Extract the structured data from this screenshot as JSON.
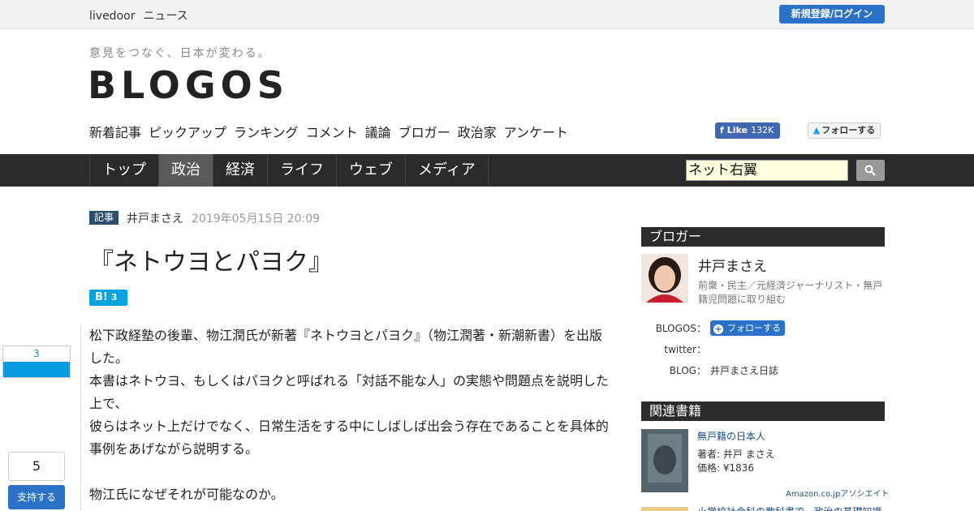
{
  "topbar": {
    "brand_1": "livedoor",
    "brand_2": "ニュース",
    "login_label": "新規登録/ログイン"
  },
  "header": {
    "tagline": "意見をつなぐ、日本が変わる。",
    "logo": "BLOGOS"
  },
  "subnav": [
    "新着記事",
    "ピックアップ",
    "ランキング",
    "コメント",
    "議論",
    "ブロガー",
    "政治家",
    "アンケート"
  ],
  "social": {
    "fb_like": "Like",
    "fb_count": "132K",
    "tw_follow": "フォローする"
  },
  "mainnav": {
    "tabs": [
      "トップ",
      "政治",
      "経済",
      "ライフ",
      "ウェブ",
      "メディア"
    ],
    "active": "政治"
  },
  "search": {
    "value": "ネット右翼"
  },
  "article": {
    "tag": "記事",
    "author": "井戸まさえ",
    "date": "2019年05月15日 20:09",
    "title": "『ネトウヨとパヨク』",
    "hatena_label": "B!",
    "hatena_count": "3",
    "paragraphs": [
      "松下政経塾の後輩、物江潤氏が新著『ネトウヨとパヨク』（物江潤著・新潮新書）を出版した。",
      "本書はネトウヨ、もしくはパヨクと呼ばれる「対話不能な人」の実態や問題点を説明した上で、",
      "彼らはネット上だけでなく、日常生活をする中にしばしば出会う存在であることを具体的事例をあげながら説明する。",
      "",
      "物江氏になぜそれが可能なのか。"
    ]
  },
  "share": {
    "count": "3",
    "support_count": "5",
    "support_label": "支持する"
  },
  "blogger_section": {
    "heading": "ブロガー",
    "name": "井戸まさえ",
    "description": "前衆・民主／元経済ジャーナリスト・無戸籍児問題に取り組む",
    "blogos_label": "BLOGOS：",
    "follow_label": "フォローする",
    "twitter_label": "twitter：",
    "blog_label": "BLOG：",
    "blog_name": "井戸まさえ日誌"
  },
  "books_section": {
    "heading": "関連書籍",
    "book_title": "無戸籍の日本人",
    "book_author": "著者: 井戸 まさえ",
    "book_price": "価格: ¥1836",
    "amazon": "Amazon.co.jpアソシエイト",
    "book2_title": "小学校社会科の教科書で、政治の基礎知識"
  }
}
